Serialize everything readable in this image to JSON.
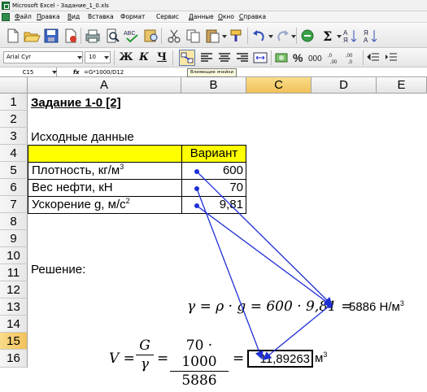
{
  "window": {
    "title": "Microsoft Excel - Задание_1_0.xls"
  },
  "menu": [
    {
      "first": "Ф",
      "rest": "айл"
    },
    {
      "first": "П",
      "rest": "равка"
    },
    {
      "first": "В",
      "rest": "ид"
    },
    {
      "first": "",
      "rest": "Вставка"
    },
    {
      "first": "",
      "rest": "Формат"
    },
    {
      "first": "",
      "rest": "Сервис"
    },
    {
      "first": "Д",
      "rest": "анные"
    },
    {
      "first": "О",
      "rest": "кно"
    },
    {
      "first": "С",
      "rest": "правка"
    }
  ],
  "toolbar": {
    "font_name": "Arial Cyr",
    "font_size": "10",
    "bold_label": "Ж",
    "italic_label": "К",
    "underline_label": "Ч",
    "tooltip": "Влияющие ячейки",
    "accent": "#fbe8a6"
  },
  "formula_bar": {
    "cell_ref": "C15",
    "fx": "fx",
    "formula": "=G*1000/D12"
  },
  "columns": [
    "A",
    "B",
    "C",
    "D",
    "E"
  ],
  "rows": [
    "1",
    "2",
    "3",
    "4",
    "5",
    "6",
    "7",
    "8",
    "9",
    "10",
    "11",
    "12",
    "13",
    "14",
    "15",
    "16"
  ],
  "sheet": {
    "title": "Задание 1-0 [2]",
    "section_input": "Исходные данные",
    "variant_header": "Вариант",
    "params": [
      {
        "label": "Плотность, кг/м",
        "sup": "3",
        "value": "600"
      },
      {
        "label": "Вес нефти, кН",
        "sup": "",
        "value": "70"
      },
      {
        "label": "Ускорение g, м/с",
        "sup": "2",
        "value": "9,81"
      }
    ],
    "section_solution": "Решение:",
    "gamma_formula": "γ = ρ · g = 600 · 9,81 =",
    "gamma_result": "5886 Н/м",
    "gamma_result_sup": "3",
    "v_lhs": "V =",
    "v_num1": "G",
    "v_den1": "γ",
    "v_eq1": "=",
    "v_num2": "70 · 1000",
    "v_den2": "5886",
    "v_eq2": "=",
    "v_result": "11,89263",
    "v_unit": "м",
    "v_unit_sup": "3",
    "highlight_color": "#ffff00",
    "arrow_color": "#1f2fd6"
  }
}
